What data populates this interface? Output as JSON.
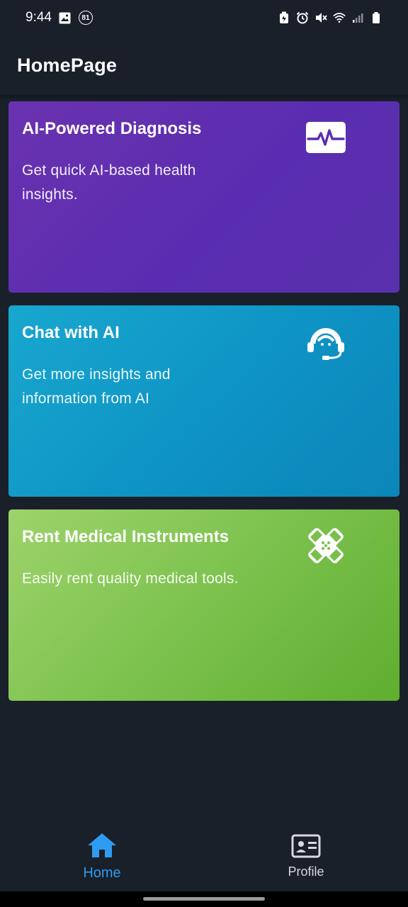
{
  "status_bar": {
    "time": "9:44",
    "notification_count": "81"
  },
  "app_bar": {
    "title": "HomePage"
  },
  "cards": [
    {
      "title": "AI-Powered Diagnosis",
      "description": "Get quick AI-based health insights.",
      "icon": "heartbeat-monitor-icon",
      "color": "#5a2db0"
    },
    {
      "title": "Chat with AI",
      "description": "Get more insights and information from AI",
      "icon": "support-agent-headset-icon",
      "color": "#0e93c4"
    },
    {
      "title": "Rent Medical Instruments",
      "description": "Easily rent quality medical tools.",
      "icon": "bandage-icon",
      "color": "#79c04b"
    }
  ],
  "bottom_nav": {
    "items": [
      {
        "label": "Home",
        "icon": "home-icon",
        "active": true
      },
      {
        "label": "Profile",
        "icon": "id-card-icon",
        "active": false
      }
    ],
    "active_color": "#2f9bf0"
  }
}
